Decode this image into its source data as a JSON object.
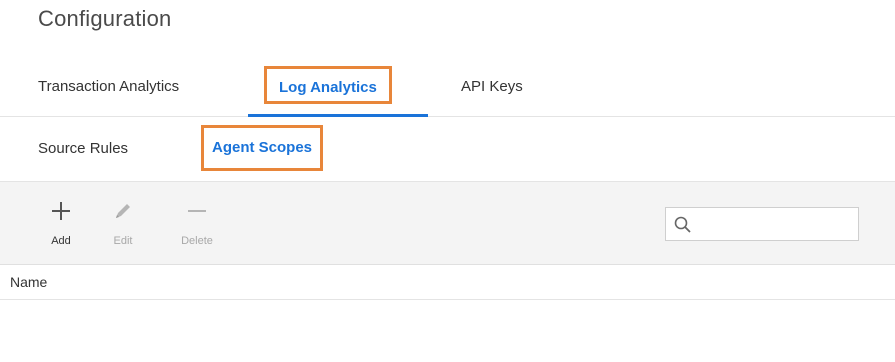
{
  "page": {
    "title": "Configuration"
  },
  "tabs": [
    {
      "label": "Transaction Analytics",
      "active": false
    },
    {
      "label": "Log Analytics",
      "active": true
    },
    {
      "label": "API Keys",
      "active": false
    }
  ],
  "subtabs": [
    {
      "label": "Source Rules",
      "active": false
    },
    {
      "label": "Agent Scopes",
      "active": true
    }
  ],
  "toolbar": {
    "add_label": "Add",
    "edit_label": "Edit",
    "delete_label": "Delete",
    "add_icon": "plus-icon",
    "edit_icon": "pencil-icon",
    "delete_icon": "minus-icon"
  },
  "search": {
    "value": "",
    "icon": "search-icon"
  },
  "table": {
    "columns": [
      "Name"
    ]
  },
  "colors": {
    "accent": "#1a73d9",
    "highlight_border": "#e8863a",
    "toolbar_bg": "#f4f4f4",
    "disabled_text": "#a8a8a8"
  }
}
